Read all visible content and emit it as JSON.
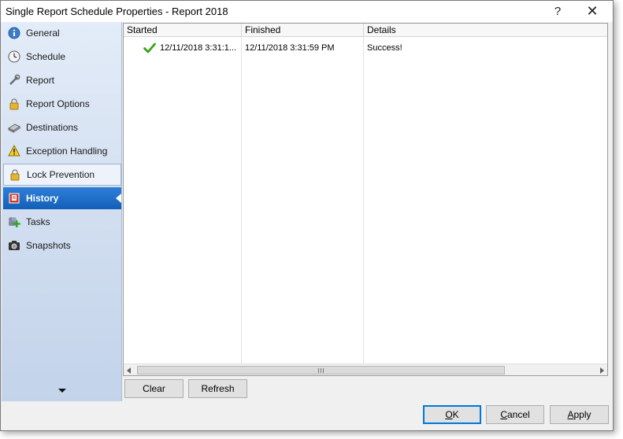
{
  "window": {
    "title": "Single Report Schedule Properties - Report 2018",
    "help_glyph": "?",
    "close_glyph": "✕"
  },
  "sidebar": {
    "items": [
      {
        "label": "General",
        "icon": "info-icon"
      },
      {
        "label": "Schedule",
        "icon": "clock-icon"
      },
      {
        "label": "Report",
        "icon": "wrench-icon"
      },
      {
        "label": "Report Options",
        "icon": "lock-icon"
      },
      {
        "label": "Destinations",
        "icon": "destination-icon"
      },
      {
        "label": "Exception Handling",
        "icon": "warning-icon"
      },
      {
        "label": "Lock Prevention",
        "icon": "lock-icon"
      },
      {
        "label": "History",
        "icon": "history-icon"
      },
      {
        "label": "Tasks",
        "icon": "tasks-icon"
      },
      {
        "label": "Snapshots",
        "icon": "camera-icon"
      }
    ],
    "selected": "History",
    "hovered": "Lock Prevention"
  },
  "history": {
    "columns": [
      "Started",
      "Finished",
      "Details"
    ],
    "rows": [
      {
        "started": "12/11/2018 3:31:1...",
        "finished": "12/11/2018 3:31:59 PM",
        "details": "Success!",
        "status_icon": "check-icon"
      }
    ]
  },
  "actions": {
    "clear": "Clear",
    "refresh": "Refresh"
  },
  "footer": {
    "ok_key": "O",
    "ok_rest": "K",
    "cancel_key": "C",
    "cancel_rest": "ancel",
    "apply_key": "A",
    "apply_rest": "pply"
  },
  "colors": {
    "accent": "#135fb8",
    "success": "#3aa21c"
  }
}
